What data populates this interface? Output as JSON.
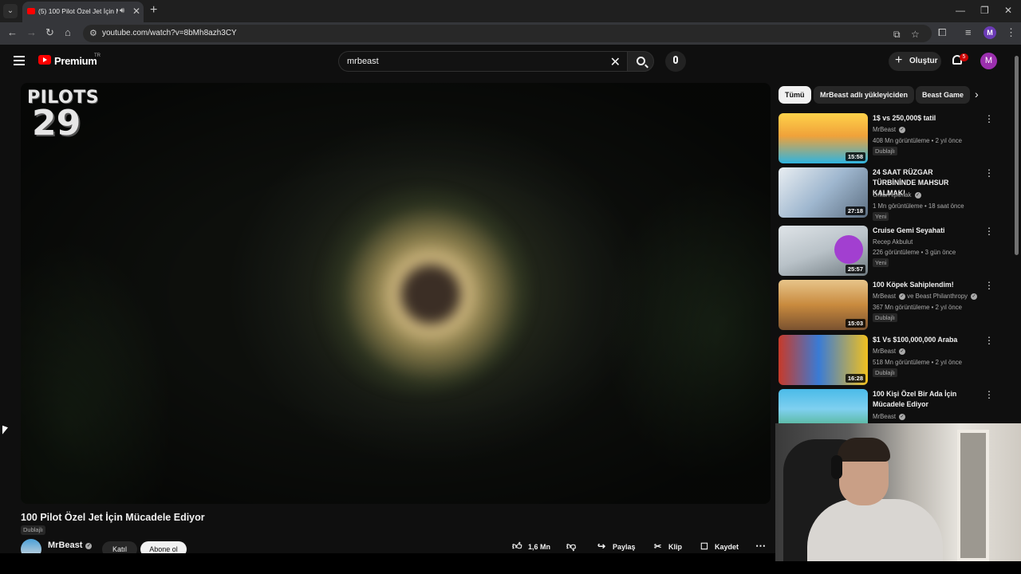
{
  "browser": {
    "tab_title": "(5) 100 Pilot Özel Jet İçin Mü",
    "url": "youtube.com/watch?v=8bMh8azh3CY",
    "profile_initial": "M"
  },
  "masthead": {
    "brand": "Premium",
    "country": "TR",
    "search_query": "mrbeast",
    "create_label": "Oluştur",
    "notification_count": "5",
    "avatar_initial": "M"
  },
  "player": {
    "overlay_line1": "PILOTS",
    "overlay_line2": "29"
  },
  "video": {
    "title": "100 Pilot Özel Jet İçin Mücadele Ediyor",
    "dub_badge": "Dublajlı",
    "channel": "MrBeast",
    "join_label": "Katıl",
    "subscribe_label": "Abone ol",
    "likes": "1,6 Mn",
    "share_label": "Paylaş",
    "clip_label": "Klip",
    "save_label": "Kaydet"
  },
  "chips": [
    "Tümü",
    "MrBeast adlı yükleyiciden",
    "Beast Game"
  ],
  "recommendations": [
    {
      "title": "1$ vs 250,000$ tatil",
      "channel": "MrBeast",
      "stats": "408 Mn görüntüleme • 2 yıl önce",
      "tag": "Dublajlı",
      "duration": "15:58",
      "thumb_colors": [
        "#ffd24a",
        "#2fb4e0"
      ]
    },
    {
      "title": "24 SAAT RÜZGAR TÜRBİNİNDE MAHSUR KALMAK!",
      "channel": "Orkun Işıtmak",
      "stats": "1 Mn görüntüleme • 18 saat önce",
      "tag": "Yeni",
      "duration": "27:18",
      "thumb_colors": [
        "#9fb7cf",
        "#e9eef2"
      ]
    },
    {
      "title": "Cruise Gemi Seyahati",
      "channel": "Recep Akbulut",
      "stats": "226 görüntüleme • 3 gün önce",
      "tag": "Yeni",
      "duration": "25:57",
      "thumb_colors": [
        "#b9c2c8",
        "#a23fd0"
      ]
    },
    {
      "title": "100 Köpek Sahiplendim!",
      "channel": "MrBeast",
      "channel_extra": "ve Beast Philanthropy",
      "stats": "367 Mn görüntüleme • 2 yıl önce",
      "tag": "Dublajlı",
      "duration": "15:03",
      "thumb_colors": [
        "#c88a3e",
        "#e8c58a"
      ]
    },
    {
      "title": "$1 Vs $100,000,000 Araba",
      "channel": "MrBeast",
      "stats": "518 Mn görüntüleme • 2 yıl önce",
      "tag": "Dublajlı",
      "duration": "16:28",
      "thumb_colors": [
        "#3a7bd5",
        "#f0c020"
      ]
    },
    {
      "title": "100 Kişi Özel Bir Ada İçin Mücadele Ediyor",
      "channel": "MrBeast",
      "stats": "",
      "tag": "",
      "duration": "",
      "thumb_colors": [
        "#4bbbe8",
        "#3aa55a"
      ]
    }
  ]
}
